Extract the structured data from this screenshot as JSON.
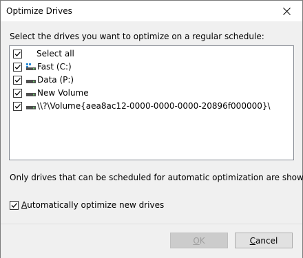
{
  "window": {
    "title": "Optimize Drives"
  },
  "instruction": "Select the drives you want to optimize on a regular schedule:",
  "drive_list": {
    "select_all": {
      "label": "Select all",
      "checked": true
    },
    "drives": [
      {
        "label": "Fast (C:)",
        "icon": "system-drive-icon",
        "checked": true
      },
      {
        "label": "Data (P:)",
        "icon": "hard-drive-icon",
        "checked": true
      },
      {
        "label": "New Volume",
        "icon": "hard-drive-icon",
        "checked": true
      },
      {
        "label": "\\\\?\\Volume{aea8ac12-0000-0000-0000-20896f000000}\\",
        "icon": "hard-drive-icon",
        "checked": true
      }
    ]
  },
  "footnote": "Only drives that can be scheduled for automatic optimization are shown.",
  "auto_optimize": {
    "accel": "A",
    "rest": "utomatically optimize new drives",
    "checked": true
  },
  "buttons": {
    "ok": {
      "accel": "O",
      "rest": "K",
      "enabled": false
    },
    "cancel": {
      "accel": "C",
      "rest": "ancel",
      "enabled": true
    }
  },
  "colors": {
    "accent_check": "#000000",
    "drive_icon": "#505050",
    "system_drive_accent": "#2a8ad4"
  }
}
